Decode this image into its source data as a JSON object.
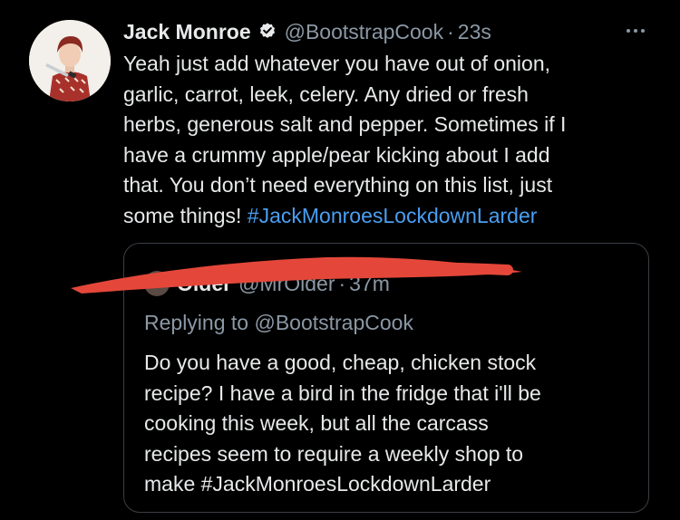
{
  "tweet": {
    "display_name": "Jack Monroe",
    "handle": "@BootstrapCook",
    "separator": "·",
    "time": "23s",
    "text_lines": [
      "Yeah just add whatever you have out of onion,",
      "garlic, carrot, leek, celery. Any dried or fresh",
      "herbs, generous salt and pepper. Sometimes if I",
      "have a crummy apple/pear kicking about I add",
      "that. You don’t need everything on this list, just"
    ],
    "last_line_text": "some things! ",
    "hashtag": "#JackMonroesLockdownLarder"
  },
  "quote": {
    "name": "Older",
    "handle": "@MrOlder",
    "separator": "·",
    "time": "37m",
    "replying_prefix": "Replying to ",
    "replying_mention": "@BootstrapCook",
    "text_lines": [
      "Do you have a good, cheap, chicken stock",
      "recipe? I have a bird in the fridge that i'll be",
      "cooking this week, but all the carcass",
      "recipes seem to require a weekly shop to"
    ],
    "last_line_text": "make ",
    "hashtag": "#JackMonroesLockdownLarder"
  },
  "icons": {
    "verified": "verified-badge-icon",
    "more": "more-options-icon"
  },
  "colors": {
    "background": "#000000",
    "text": "#e7e9ea",
    "muted": "#8b98a5",
    "link": "#4a9ff2",
    "redaction": "#e4473a"
  }
}
